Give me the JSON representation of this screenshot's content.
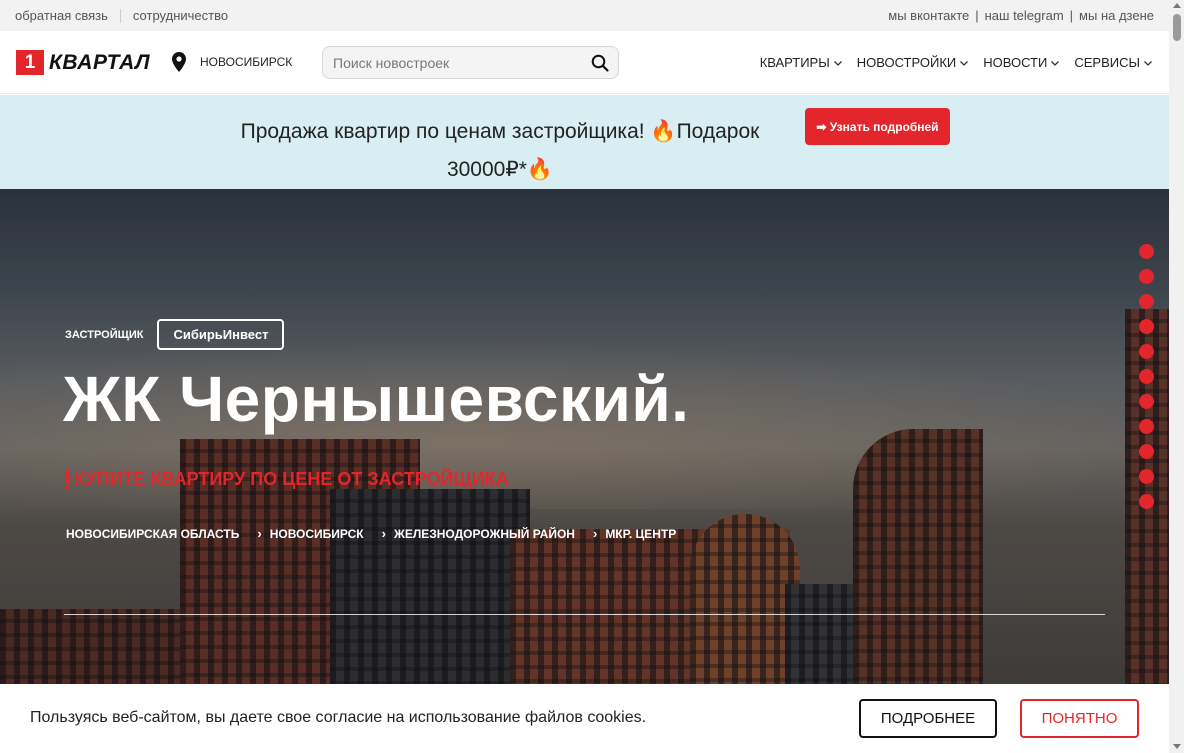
{
  "topbar": {
    "left_links": [
      "обратная связь",
      "сотрудничество"
    ],
    "right_links": [
      "мы вконтакте",
      "наш telegram",
      "мы на дзене"
    ],
    "separator": "|"
  },
  "header": {
    "logo_number": "1",
    "logo_word": "КВАРТАЛ",
    "city": "НОВОСИБИРСК",
    "search_placeholder": "Поиск новостроек",
    "nav": [
      "КВАРТИРЫ",
      "НОВОСТРОЙКИ",
      "НОВОСТИ",
      "СЕРВИСЫ"
    ]
  },
  "promo": {
    "text_line1": "Продажа квартир по ценам застройщика! 🔥Подарок",
    "text_line2": "30000₽*🔥",
    "button_label": "➡ Узнать подробней"
  },
  "hero": {
    "developer_label": "ЗАСТРОЙЩИК",
    "developer_name": "СибирьИнвест",
    "title": "ЖК Чернышевский.",
    "subtitle": "КУПИТЕ КВАРТИРУ ПО ЦЕНЕ ОТ ЗАСТРОЙЩИКА",
    "breadcrumbs": [
      "НОВОСИБИРСКАЯ ОБЛАСТЬ",
      "НОВОСИБИРСК",
      "ЖЕЛЕЗНОДОРОЖНЫЙ РАЙОН",
      "МКР. ЦЕНТР"
    ],
    "breadcrumb_arrow": "›",
    "slider_dots_count": 11
  },
  "cookie": {
    "message": "Пользуясь веб-сайтом, вы даете свое согласие на использование файлов cookies.",
    "more_label": "ПОДРОБНЕЕ",
    "ok_label": "ПОНЯТНО"
  },
  "colors": {
    "accent": "#e3262b",
    "promo_bg": "#d8eef2",
    "topbar_bg": "#f2f2f2"
  }
}
